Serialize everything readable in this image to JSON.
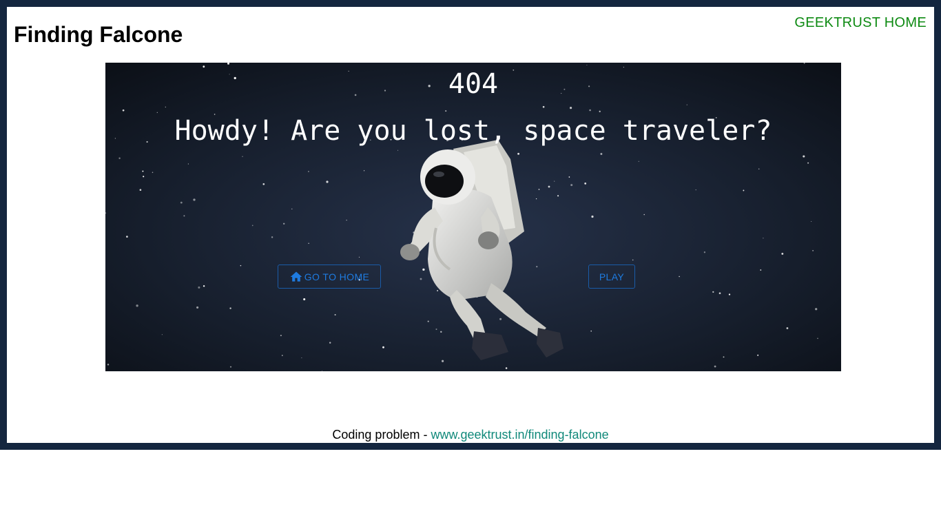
{
  "header": {
    "title": "Finding Falcone",
    "home_link": "GEEKTRUST HOME"
  },
  "hero": {
    "code": "404",
    "headline": "Howdy! Are you lost, space traveler?",
    "buttons": {
      "home_label": "GO TO HOME",
      "play_label": "PLAY"
    }
  },
  "footer": {
    "prefix": "Coding problem - ",
    "link_text": "www.geektrust.in/finding-falcone"
  },
  "colors": {
    "frame": "#14263f",
    "space": "#1b2433",
    "link_green": "#0d8a12",
    "footer_link": "#10897a",
    "button_blue": "#1e7be0"
  },
  "icons": {
    "home_button_icon": "home-icon"
  }
}
